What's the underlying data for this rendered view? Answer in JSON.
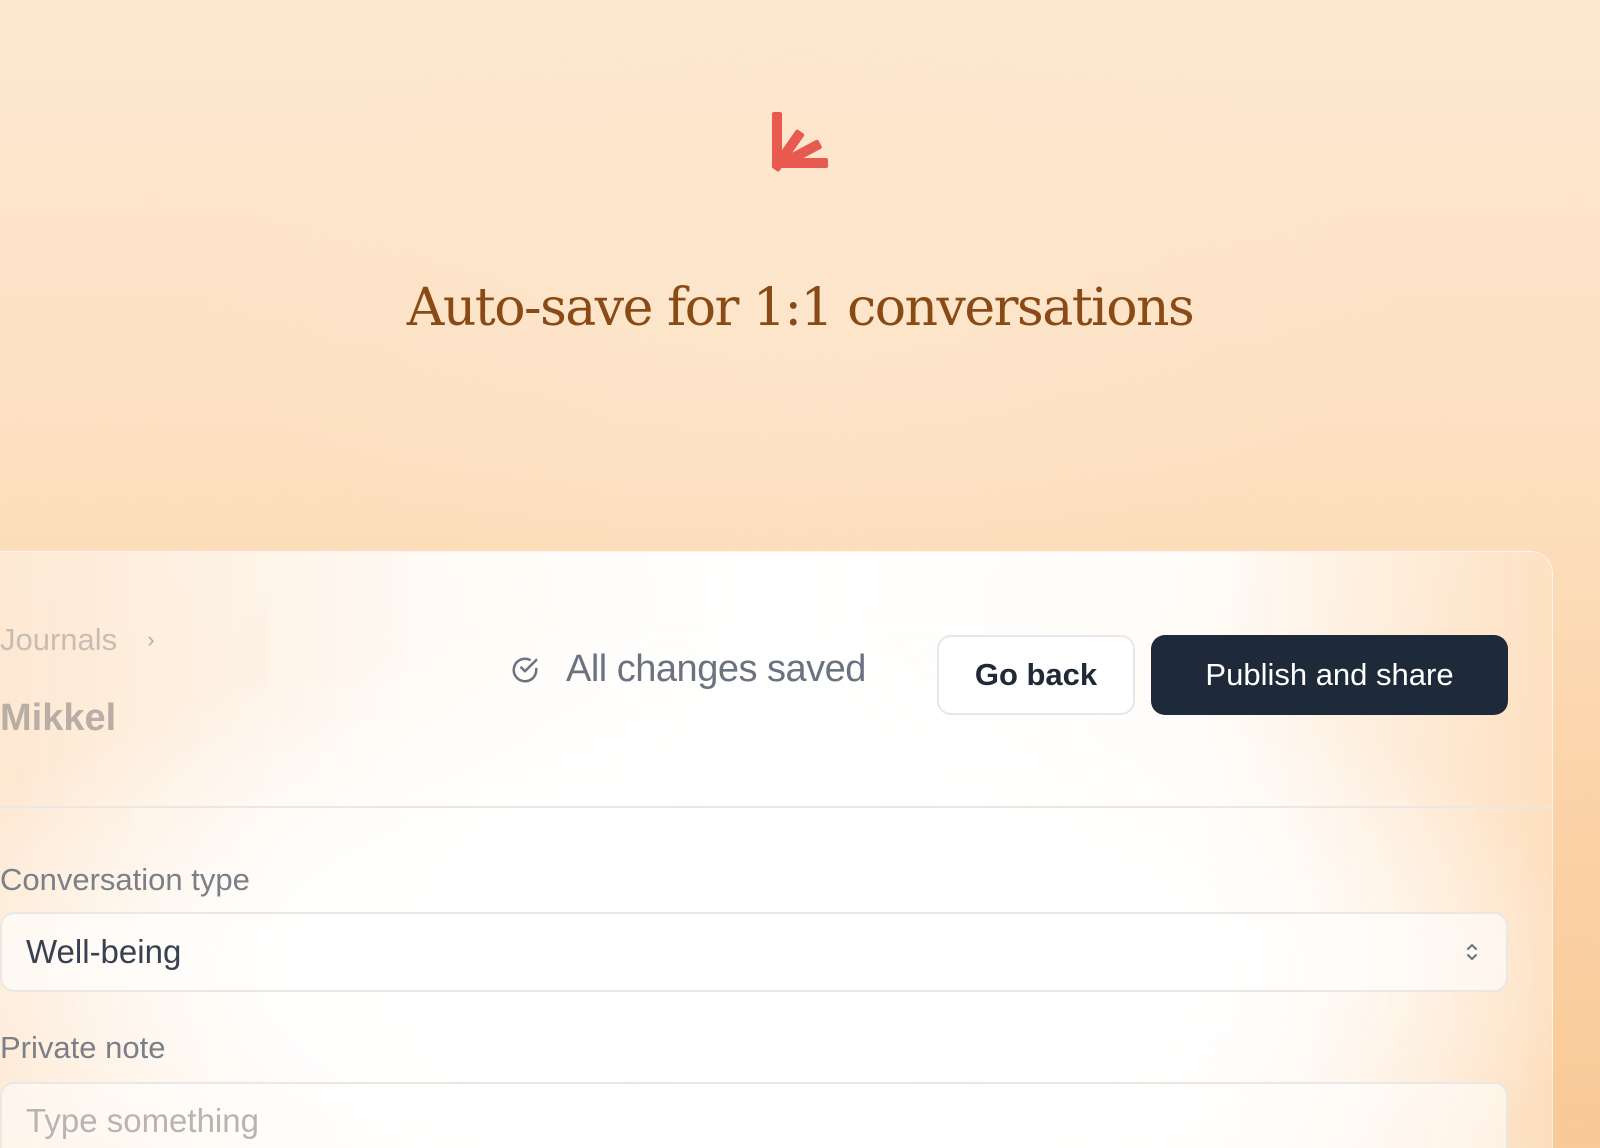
{
  "hero": {
    "logo_icon": "sparkle-burst-icon",
    "title": "Auto-save for 1:1 conversations"
  },
  "header": {
    "breadcrumb": [
      "Journals"
    ],
    "breadcrumb_separator": "›",
    "title": "Mikkel",
    "save_status": "All changes saved",
    "save_status_icon": "check-circle-icon",
    "go_back_label": "Go back",
    "publish_label": "Publish and share"
  },
  "form": {
    "conversation_type": {
      "label": "Conversation type",
      "value": "Well-being"
    },
    "private_note": {
      "label": "Private note",
      "placeholder": "Type something"
    }
  },
  "colors": {
    "accent": "#e85a4f",
    "title": "#8a4a16",
    "primary_button": "#1e2939"
  }
}
